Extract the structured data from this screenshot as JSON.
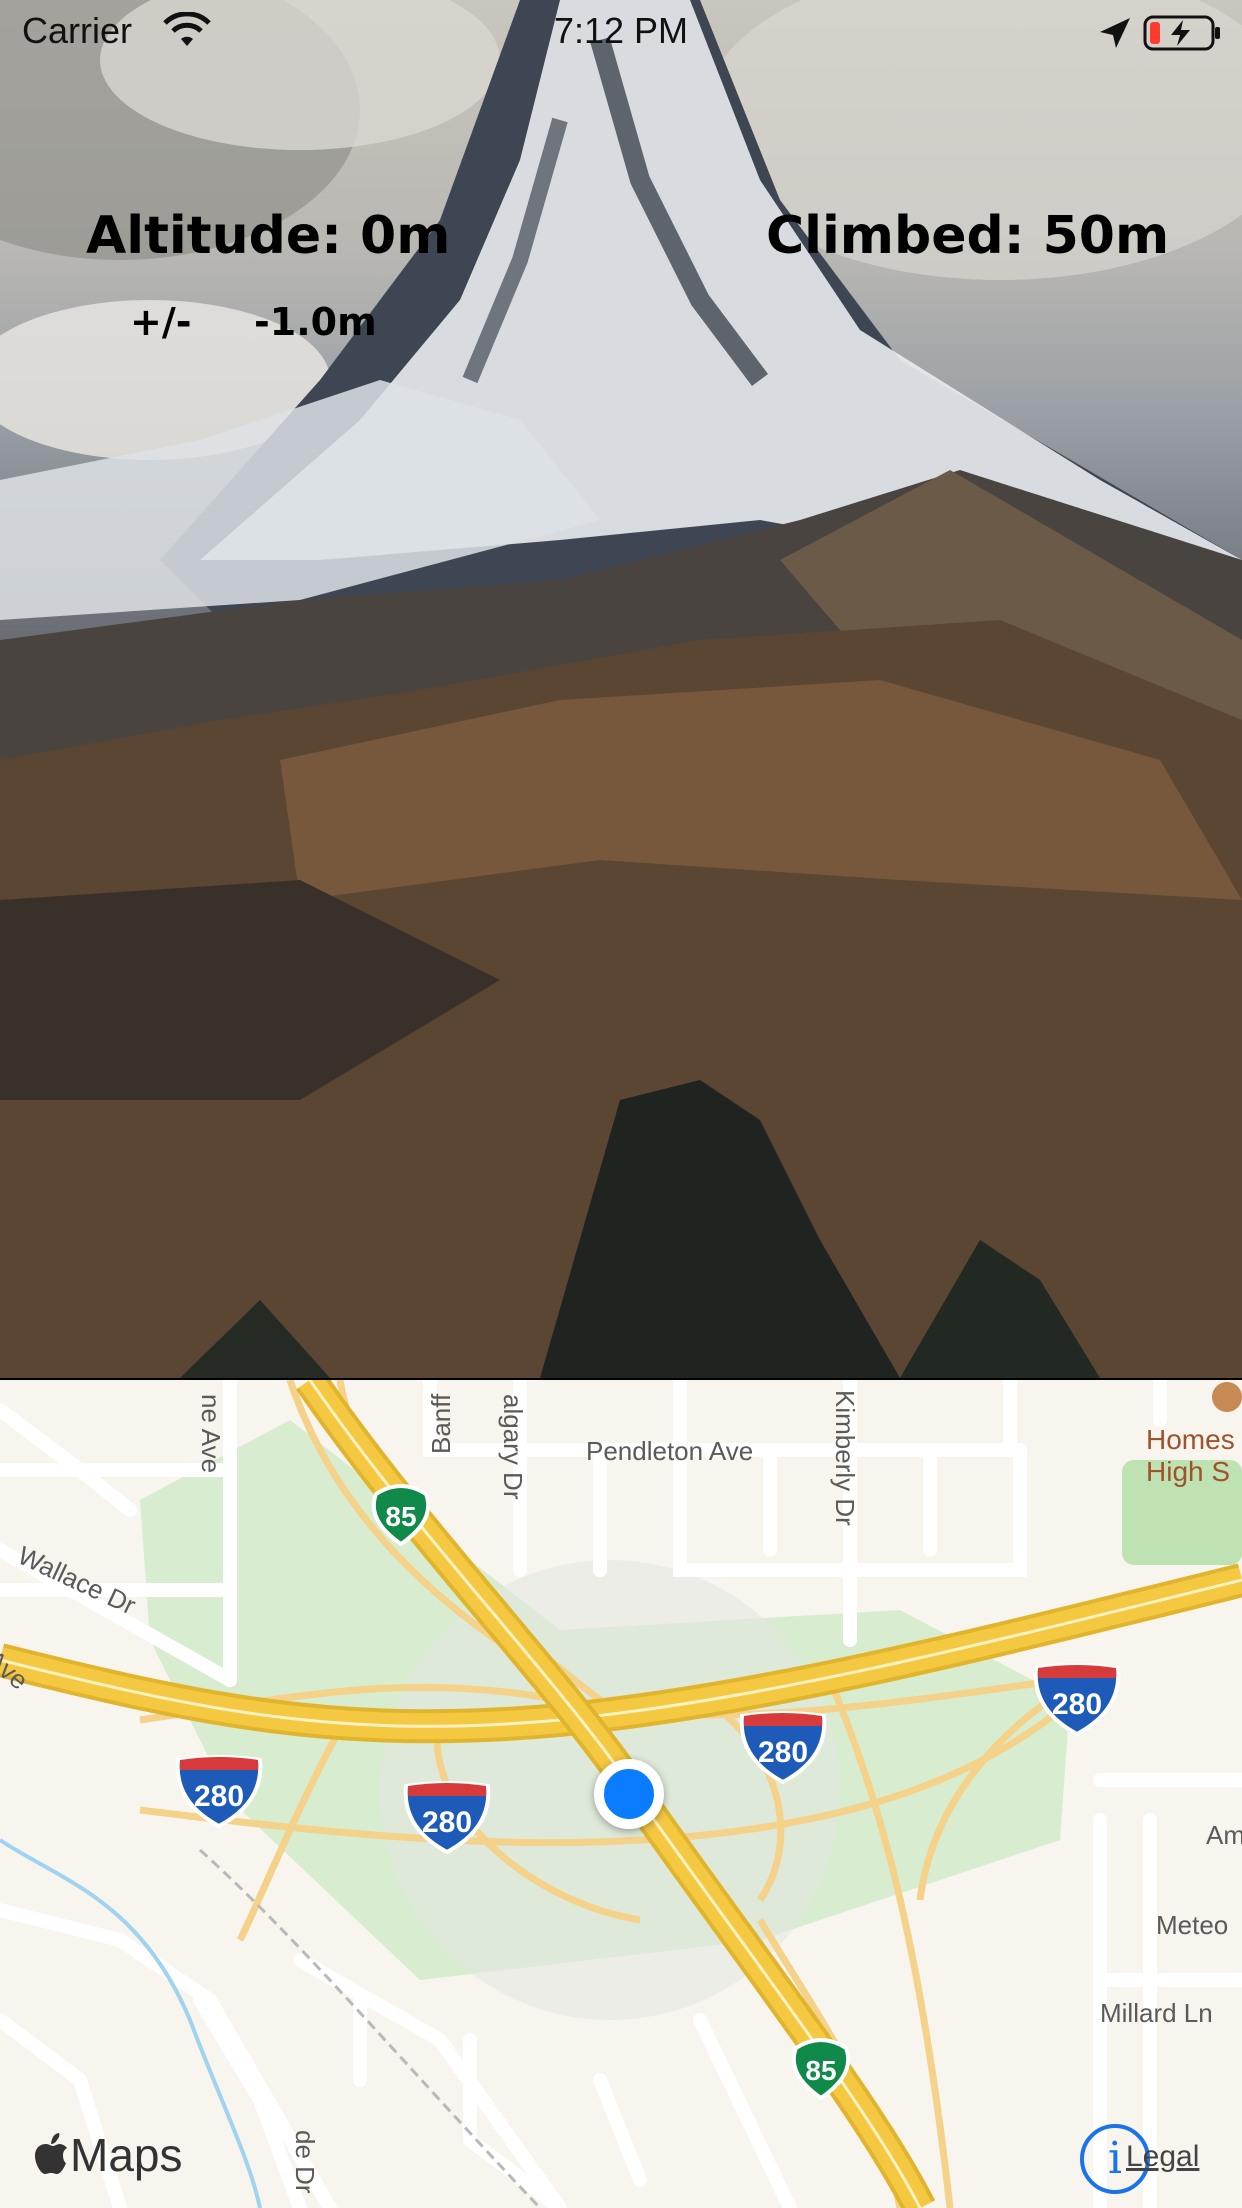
{
  "status_bar": {
    "carrier": "Carrier",
    "time": "7:12 PM"
  },
  "readout": {
    "altitude": "Altitude: 0m",
    "climbed": "Climbed: 50m",
    "plus_minus": "+/-",
    "accuracy": "-1.0m"
  },
  "map": {
    "streets": [
      "ne Ave",
      "Banff",
      "algary Dr",
      "Pendleton Ave",
      "Kimberly Dr",
      "Wallace Dr",
      "Ave",
      "Am",
      "Meteo",
      "Millard Ln",
      "de Dr"
    ],
    "poi": [
      "Homes",
      "High S"
    ],
    "shields": {
      "i280": "280",
      "ca85": "85"
    },
    "logo": "Maps",
    "legal": "Legal",
    "info": "i"
  },
  "colors": {
    "user_dot": "#0a7cff",
    "freeway": "#f5c842",
    "green_area": "#d8ecd0"
  }
}
